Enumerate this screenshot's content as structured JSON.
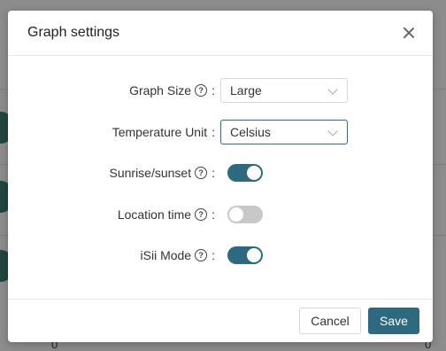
{
  "dialog": {
    "title": "Graph settings",
    "fields": {
      "graph_size": {
        "label": "Graph Size",
        "value": "Large"
      },
      "temperature_unit": {
        "label": "Temperature Unit",
        "value": "Celsius"
      },
      "sunrise_sunset": {
        "label": "Sunrise/sunset",
        "enabled": true
      },
      "location_time": {
        "label": "Location time",
        "enabled": false
      },
      "isii_mode": {
        "label": "iSii Mode",
        "enabled": true
      }
    },
    "colon": ":",
    "help_glyph": "?",
    "buttons": {
      "cancel": "Cancel",
      "save": "Save"
    }
  },
  "background": {
    "counters": [
      "0",
      "0"
    ]
  },
  "colors": {
    "accent": "#2d6a7f",
    "toggle_off": "#c8c8c8"
  }
}
